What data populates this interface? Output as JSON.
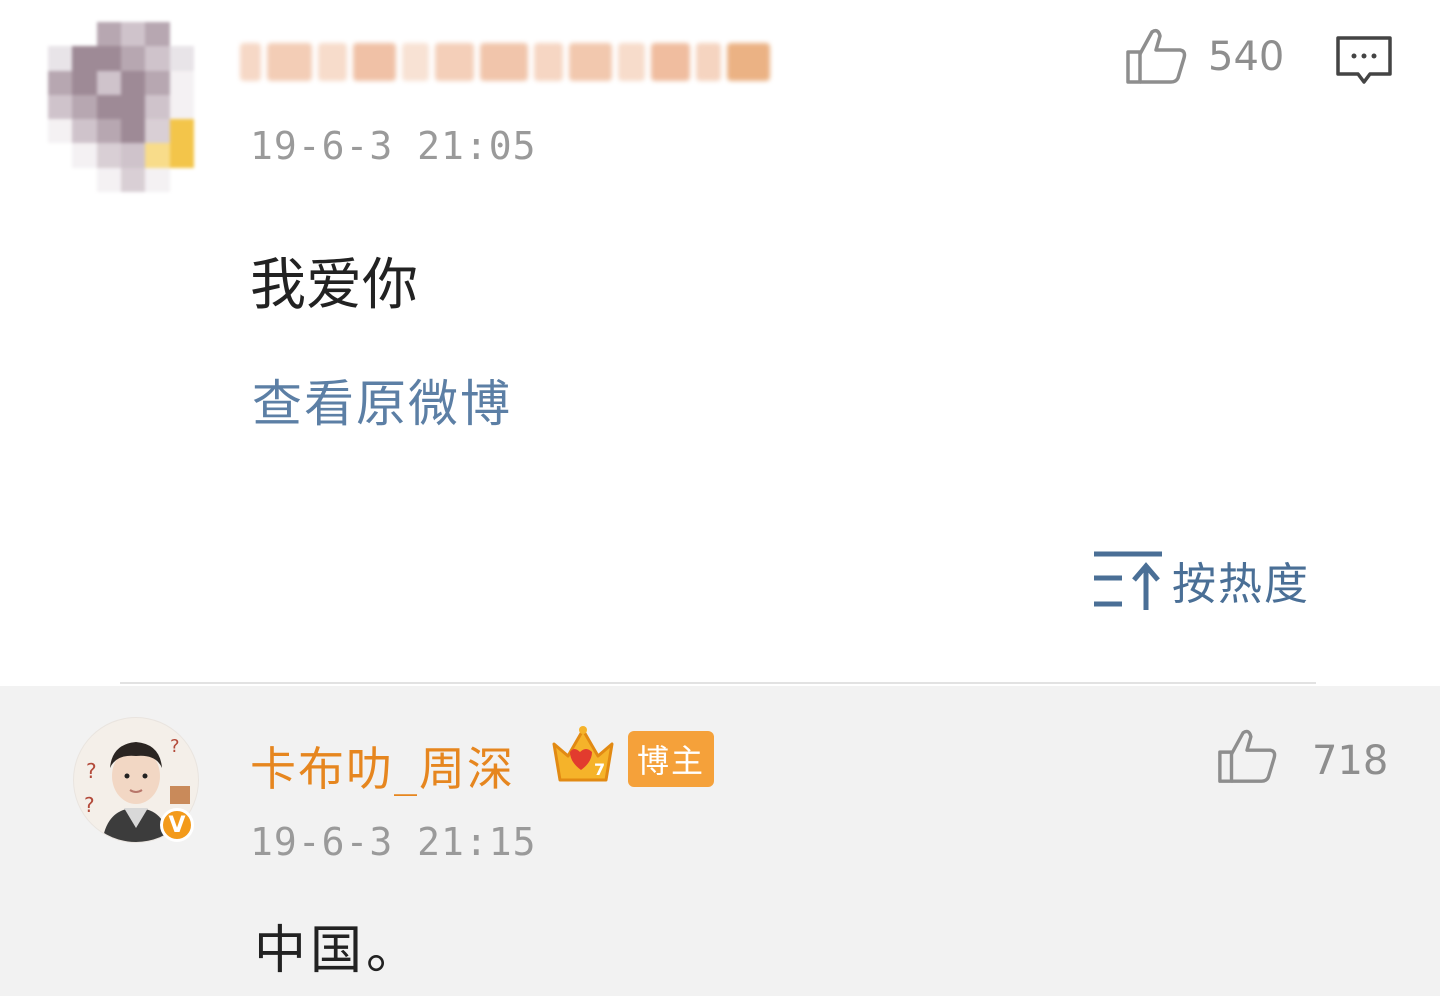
{
  "comment": {
    "timestamp": "19-6-3 21:05",
    "text": "我爱你",
    "like_count": "540",
    "view_original": "查看原微博",
    "icons": {
      "like": "thumbs-up-icon",
      "reply": "comment-bubble-icon"
    }
  },
  "sort": {
    "label": "按热度",
    "icon": "sort-ascending-icon"
  },
  "reply": {
    "author": "卡布叻_周深",
    "badge": "博主",
    "verified_mark": "V",
    "level_number": "7",
    "timestamp": "19-6-3 21:15",
    "text": "中国。",
    "like_count": "718",
    "icons": {
      "like": "thumbs-up-icon",
      "crown": "crown-icon",
      "verified": "verified-badge-icon"
    }
  },
  "colors": {
    "link": "#5c7fa5",
    "author": "#e6861f",
    "badge": "#f5a13a",
    "muted": "#9a9a9a",
    "reply_bg": "#f2f2f2"
  }
}
